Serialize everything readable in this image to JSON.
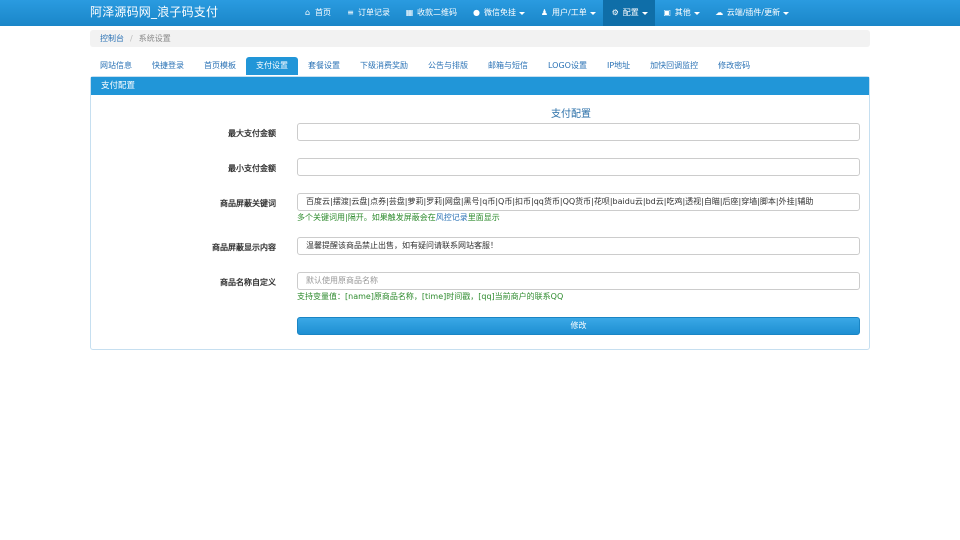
{
  "header": {
    "brand": "阿泽源码网_浪子码支付",
    "nav": [
      {
        "icon": "home-icon",
        "glyph": "⌂",
        "label": "首页",
        "dropdown": false,
        "active": false
      },
      {
        "icon": "list-icon",
        "glyph": "≡",
        "label": "订单记录",
        "dropdown": false,
        "active": false
      },
      {
        "icon": "qrcode-icon",
        "glyph": "▦",
        "label": "收款二维码",
        "dropdown": false,
        "active": false
      },
      {
        "icon": "wechat-icon",
        "glyph": "●",
        "label": "微信免挂",
        "dropdown": true,
        "active": false
      },
      {
        "icon": "user-icon",
        "glyph": "♟",
        "label": "用户/工单",
        "dropdown": true,
        "active": false
      },
      {
        "icon": "gear-icon",
        "glyph": "⚙",
        "label": "配置",
        "dropdown": true,
        "active": true
      },
      {
        "icon": "briefcase-icon",
        "glyph": "▣",
        "label": "其他",
        "dropdown": true,
        "active": false
      },
      {
        "icon": "cloud-icon",
        "glyph": "☁",
        "label": "云端/插件/更新",
        "dropdown": true,
        "active": false
      }
    ]
  },
  "breadcrumb": {
    "home": "控制台",
    "separator": "/",
    "current": "系统设置"
  },
  "tabs": [
    {
      "label": "网站信息",
      "active": false
    },
    {
      "label": "快捷登录",
      "active": false
    },
    {
      "label": "首页模板",
      "active": false
    },
    {
      "label": "支付设置",
      "active": true
    },
    {
      "label": "套餐设置",
      "active": false
    },
    {
      "label": "下级消费奖励",
      "active": false
    },
    {
      "label": "公告与排版",
      "active": false
    },
    {
      "label": "邮箱与短信",
      "active": false
    },
    {
      "label": "LOGO设置",
      "active": false
    },
    {
      "label": "IP地址",
      "active": false
    },
    {
      "label": "加快回调监控",
      "active": false
    },
    {
      "label": "修改密码",
      "active": false
    }
  ],
  "panel": {
    "heading": "支付配置",
    "form_title": "支付配置",
    "fields": {
      "max_amount": {
        "label": "最大支付金额",
        "value": "",
        "placeholder": ""
      },
      "min_amount": {
        "label": "最小支付金额",
        "value": "",
        "placeholder": ""
      },
      "keywords": {
        "label": "商品屏蔽关键词",
        "value": "百度云|摆渡|云盘|点券|芸盘|萝莉|罗莉|网盘|黑号|q币|Q币|扣币|qq货币|QQ货币|花呗|baidu云|bd云|吃鸡|透视|自瞄|后座|穿墙|脚本|外挂|辅助",
        "help_prefix": "多个关键词用|隔开。如果触发屏蔽会在",
        "help_link": "风控记录",
        "help_suffix": "里面显示"
      },
      "block_message": {
        "label": "商品屏蔽显示内容",
        "value": "温馨提醒该商品禁止出售，如有疑问请联系网站客服！"
      },
      "name_custom": {
        "label": "商品名称自定义",
        "value": "",
        "placeholder": "默认使用原商品名称",
        "help": "支持变量值：[name]原商品名称，[time]时间戳，[qq]当前商户的联系QQ"
      }
    },
    "submit_label": "修改"
  },
  "colors": {
    "primary": "#2196d8",
    "nav_active": "#0f6ea8",
    "help_green": "#2e8b2e",
    "link_blue": "#2a72b5"
  }
}
